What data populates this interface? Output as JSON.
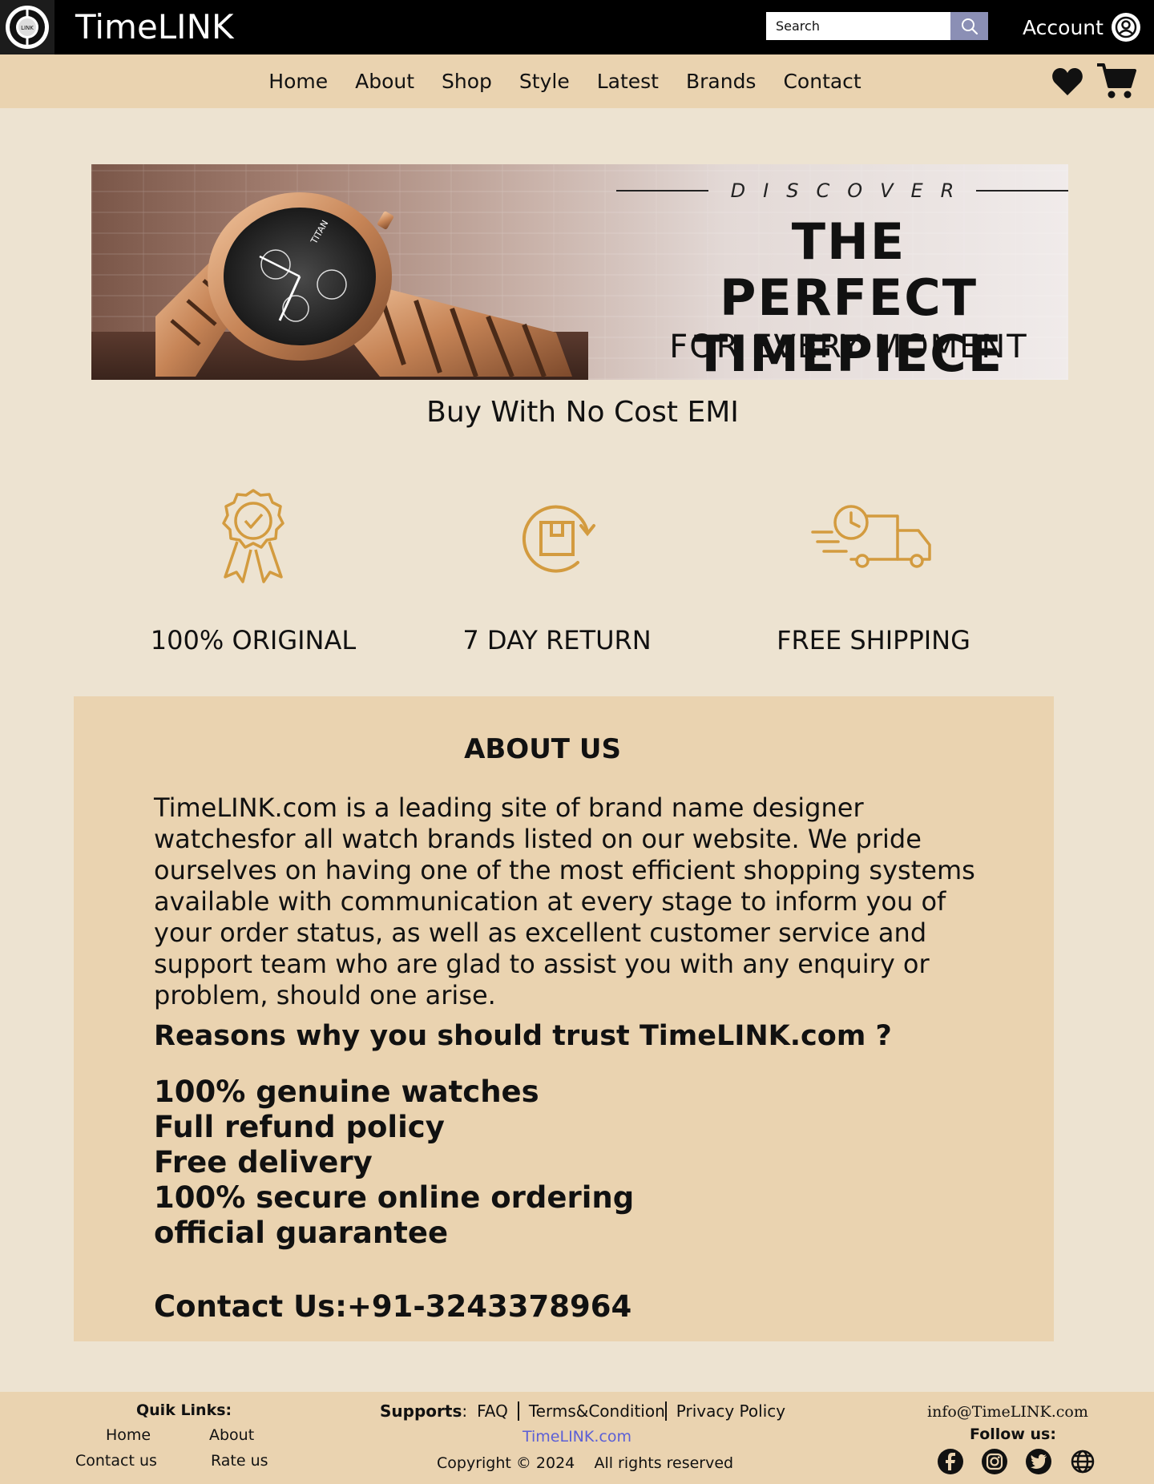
{
  "header": {
    "brand": "TimeLINK",
    "logo_text": "LINK",
    "search": {
      "placeholder": "Search"
    },
    "account_label": "Account"
  },
  "nav": {
    "items": [
      "Home",
      "About",
      "Shop",
      "Style",
      "Latest",
      "Brands",
      "Contact"
    ]
  },
  "banner": {
    "discover": "DISCOVER",
    "headline_line1": "THE PERFECT",
    "headline_line2": "TIMEPIECE",
    "subline": "FOR EVERY MOMENT",
    "watch_brand": "TITAN"
  },
  "emi_text": "Buy With No Cost EMI",
  "features": [
    {
      "label": "100% ORIGINAL",
      "icon": "award-badge-icon"
    },
    {
      "label": "7 DAY RETURN",
      "icon": "return-box-icon"
    },
    {
      "label": "FREE SHIPPING",
      "icon": "delivery-truck-icon"
    }
  ],
  "about": {
    "title": "ABOUT US",
    "paragraph": "TimeLINK.com is a leading site of brand name designer watchesfor all watch brands listed on our website. We pride ourselves on having one of the most efficient shopping systems available with communication at every stage to inform you of your order status, as well as excellent customer service and support team who are glad to assist you with any enquiry or problem, should one arise.",
    "trust_title": "Reasons why you should trust TimeLINK.com ?",
    "trust_items": [
      "100% genuine watches",
      "Full refund policy",
      "Free delivery",
      "100% secure online ordering",
      "official guarantee"
    ],
    "contact": "Contact Us:+91-3243378964"
  },
  "footer": {
    "quick_title": "Quik Links:",
    "quick_links": [
      "Home",
      "About",
      "Contact us",
      "Rate us"
    ],
    "supports_label": "Supports",
    "supports_colon": ":",
    "support_links": [
      "FAQ",
      "Terms&Condition",
      "Privacy Policy"
    ],
    "site": "TimeLINK.com",
    "copyright": "Copyright © 2024",
    "rights": "All rights reserved",
    "email": "info@TimeLINK.com",
    "follow": "Follow us:",
    "socials": [
      "facebook-icon",
      "instagram-icon",
      "twitter-icon",
      "globe-icon"
    ]
  },
  "colors": {
    "topbar": "#000000",
    "navbar": "#ead3b0",
    "page_bg": "#ede3d1",
    "accent_gold": "#d39b3f",
    "search_button": "#8b8fb5",
    "footer_link": "#5b5fd6"
  }
}
